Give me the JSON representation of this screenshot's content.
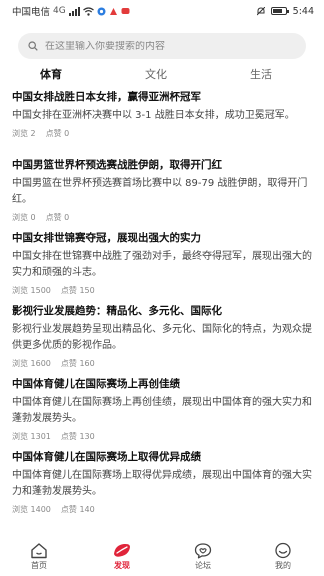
{
  "status_bar": {
    "carrier": "中国电信",
    "net": "4G",
    "time": "5:44"
  },
  "search": {
    "placeholder": "在这里输入你要搜索的内容"
  },
  "tabs": [
    {
      "label": "体育",
      "active": true
    },
    {
      "label": "文化",
      "active": false
    },
    {
      "label": "生活",
      "active": false
    }
  ],
  "articles": [
    {
      "title": "中国女排战胜日本女排，赢得亚洲杯冠军",
      "body": "中国女排在亚洲杯决赛中以 3-1 战胜日本女排，成功卫冕冠军。",
      "views": "浏览 2",
      "likes": "点赞 0"
    },
    {
      "title": "中国男篮世界杯预选赛战胜伊朗，取得开门红",
      "body": "中国男篮在世界杯预选赛首场比赛中以 89-79 战胜伊朗，取得开门红。",
      "views": "浏览 0",
      "likes": "点赞 0"
    },
    {
      "title": "中国女排世锦赛夺冠，展现出强大的实力",
      "body": "中国女排在世锦赛中战胜了强劲对手，最终夺得冠军，展现出强大的实力和顽强的斗志。",
      "views": "浏览 1500",
      "likes": "点赞 150"
    },
    {
      "title": "影视行业发展趋势：精品化、多元化、国际化",
      "body": "影视行业发展趋势呈现出精品化、多元化、国际化的特点，为观众提供更多优质的影视作品。",
      "views": "浏览 1600",
      "likes": "点赞 160"
    },
    {
      "title": "中国体育健儿在国际赛场上再创佳绩",
      "body": "中国体育健儿在国际赛场上再创佳绩，展现出中国体育的强大实力和蓬勃发展势头。",
      "views": "浏览 1301",
      "likes": "点赞 130"
    },
    {
      "title": "中国体育健儿在国际赛场上取得优异成绩",
      "body": "中国体育健儿在国际赛场上取得优异成绩，展现出中国体育的强大实力和蓬勃发展势头。",
      "views": "浏览 1400",
      "likes": "点赞 140"
    }
  ],
  "nav": [
    {
      "label": "首页",
      "icon": "home-icon",
      "active": false
    },
    {
      "label": "发现",
      "icon": "discover-icon",
      "active": true
    },
    {
      "label": "论坛",
      "icon": "forum-icon",
      "active": false
    },
    {
      "label": "我的",
      "icon": "profile-icon",
      "active": false
    }
  ],
  "colors": {
    "accent": "#e0243a",
    "search_bg": "#efefef"
  }
}
